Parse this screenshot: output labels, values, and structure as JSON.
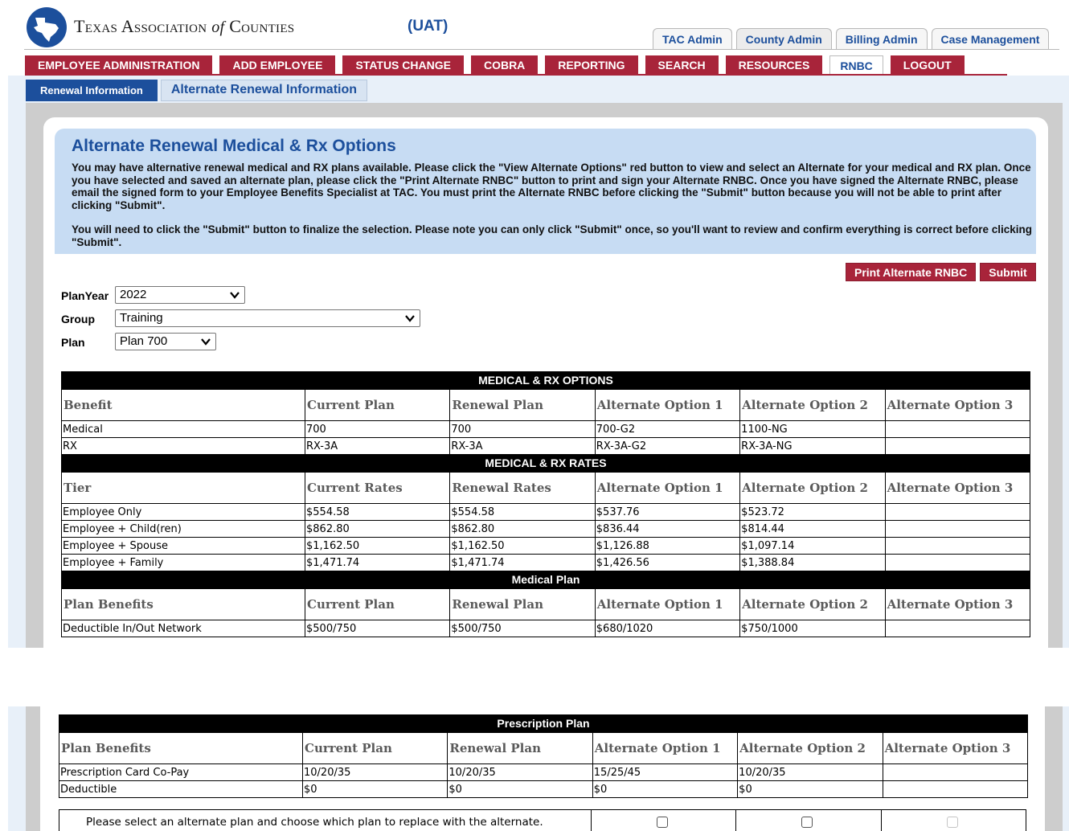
{
  "header": {
    "org_name_prefix": "Texas Association",
    "org_name_of": "of",
    "org_name_suffix": "Counties",
    "environment": "(UAT)"
  },
  "admin_tabs": [
    "TAC Admin",
    "County Admin",
    "Billing Admin",
    "Case Management"
  ],
  "main_nav": [
    "EMPLOYEE ADMINISTRATION",
    "ADD EMPLOYEE",
    "STATUS CHANGE",
    "COBRA",
    "REPORTING",
    "SEARCH",
    "RESOURCES",
    "RNBC",
    "LOGOUT"
  ],
  "sub_tabs": [
    "Renewal Information",
    "Alternate Renewal Information"
  ],
  "info": {
    "title": "Alternate Renewal Medical & Rx Options",
    "para1": "You may have alternative renewal medical and RX plans available. Please click the \"View Alternate Options\" red button to view and select an Alternate for your medical and RX plan. Once you have selected and saved an alternate plan, please click the \"Print Alternate RNBC\" button to print and sign your Alternate RNBC. Once you have signed the Alternate RNBC, please email the signed form to your Employee Benefits Specialist at TAC. You must print the Alternate RNBC before clicking the \"Submit\" button because you will not be able to print after clicking \"Submit\".",
    "para2": "You will need to click the \"Submit\" button to finalize the selection. Please note you can only click \"Submit\" once, so you'll want to review and confirm everything is correct before clicking \"Submit\"."
  },
  "actions": {
    "print_label": "Print Alternate RNBC",
    "submit_label": "Submit"
  },
  "filters": {
    "plan_year_label": "PlanYear",
    "plan_year_value": "2022",
    "group_label": "Group",
    "group_value": "Training",
    "plan_label": "Plan",
    "plan_value": "Plan 700"
  },
  "tables": {
    "options": {
      "band": "MEDICAL & RX OPTIONS",
      "headers": [
        "Benefit",
        "Current Plan",
        "Renewal Plan",
        "Alternate Option 1",
        "Alternate Option 2",
        "Alternate Option 3"
      ],
      "rows": [
        [
          "Medical",
          "700",
          "700",
          "700-G2",
          "1100-NG",
          ""
        ],
        [
          "RX",
          "RX-3A",
          "RX-3A",
          "RX-3A-G2",
          "RX-3A-NG",
          ""
        ]
      ]
    },
    "rates": {
      "band": "MEDICAL & RX RATES",
      "headers": [
        "Tier",
        "Current Rates",
        "Renewal Rates",
        "Alternate Option 1",
        "Alternate Option 2",
        "Alternate Option 3"
      ],
      "rows": [
        [
          "Employee Only",
          "$554.58",
          "$554.58",
          "$537.76",
          "$523.72",
          ""
        ],
        [
          "Employee + Child(ren)",
          "$862.80",
          "$862.80",
          "$836.44",
          "$814.44",
          ""
        ],
        [
          "Employee + Spouse",
          "$1,162.50",
          "$1,162.50",
          "$1,126.88",
          "$1,097.14",
          ""
        ],
        [
          "Employee + Family",
          "$1,471.74",
          "$1,471.74",
          "$1,426.56",
          "$1,388.84",
          ""
        ]
      ]
    },
    "medical": {
      "band": "Medical Plan",
      "headers": [
        "Plan Benefits",
        "Current Plan",
        "Renewal Plan",
        "Alternate Option 1",
        "Alternate Option 2",
        "Alternate Option 3"
      ],
      "rows": [
        [
          "Deductible In/Out Network",
          "$500/750",
          "$500/750",
          "$680/1020",
          "$750/1000",
          ""
        ]
      ]
    },
    "prescription": {
      "band": "Prescription Plan",
      "headers": [
        "Plan Benefits",
        "Current Plan",
        "Renewal Plan",
        "Alternate Option 1",
        "Alternate Option 2",
        "Alternate Option 3"
      ],
      "rows": [
        [
          "Prescription Card Co-Pay",
          "10/20/35",
          "10/20/35",
          "15/25/45",
          "10/20/35",
          ""
        ],
        [
          "Deductible",
          "$0",
          "$0",
          "$0",
          "$0",
          ""
        ]
      ]
    }
  },
  "selection": {
    "message": "Please select an alternate plan and choose which plan to replace with the alternate."
  },
  "colors": {
    "nav_red": "#a8243a",
    "brand_blue": "#1c4f9c",
    "info_blue": "#c7dcf3"
  }
}
